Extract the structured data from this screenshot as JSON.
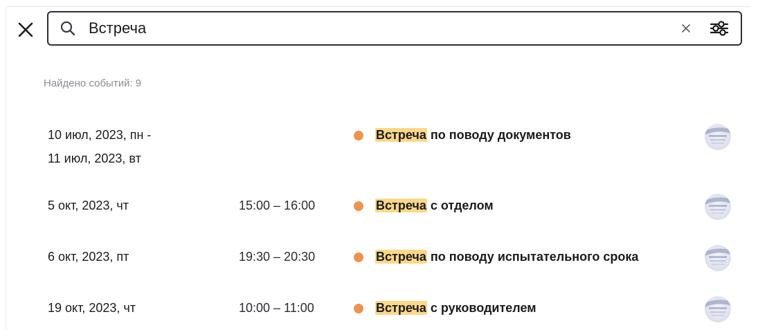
{
  "search": {
    "value": "Встреча"
  },
  "results": {
    "count_label": "Найдено событий: 9"
  },
  "events": [
    {
      "date": "10 июл, 2023, пн -",
      "date_line2": "11 июл, 2023, вт",
      "time": "",
      "title_highlight": "Встреча",
      "title_rest": " по поводу документов"
    },
    {
      "date": "5 окт, 2023, чт",
      "time": "15:00 – 16:00",
      "title_highlight": "Встреча",
      "title_rest": " с отделом"
    },
    {
      "date": "6 окт, 2023, пт",
      "time": "19:30 – 20:30",
      "title_highlight": "Встреча",
      "title_rest": " по поводу испытательного срока"
    },
    {
      "date": "19 окт, 2023, чт",
      "time": "10:00 – 11:00",
      "title_highlight": "Встреча",
      "title_rest": " с руководителем"
    }
  ],
  "colors": {
    "event_dot": "#f0924d",
    "highlight": "#fcd887",
    "border": "#2b2e3a",
    "muted_text": "#8b8c93"
  },
  "icons": {
    "close": "close-icon",
    "search": "search-icon",
    "clear": "clear-icon",
    "filter": "filter-sliders-icon",
    "avatar": "avatar"
  }
}
